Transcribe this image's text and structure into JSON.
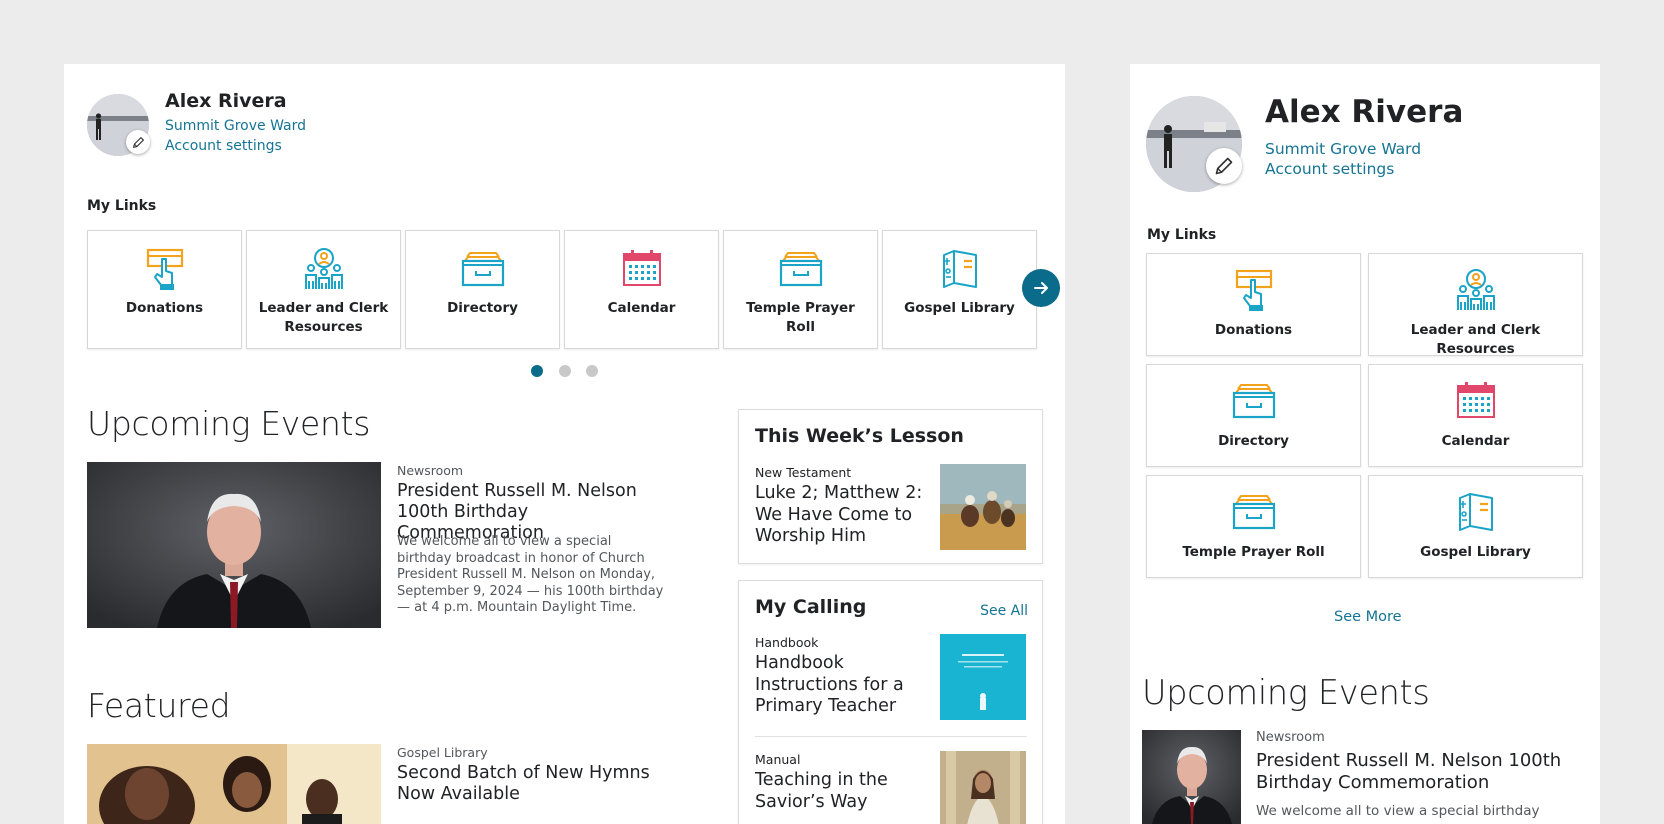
{
  "colors": {
    "page_bg": "#ececec",
    "link": "#157493",
    "accent_blue": "#0b6b8a",
    "icon_orange": "#f3a21b",
    "icon_teal": "#1aa4c7",
    "icon_pink": "#e0476a"
  },
  "user": {
    "name": "Alex Rivera",
    "ward": "Summit Grove Ward",
    "account_settings": "Account settings"
  },
  "my_links": {
    "label": "My Links",
    "items": [
      {
        "label": "Donations",
        "icon": "donation-hand-icon"
      },
      {
        "label": "Leader and Clerk Resources",
        "icon": "leader-people-icon"
      },
      {
        "label": "Directory",
        "icon": "directory-drawer-icon"
      },
      {
        "label": "Calendar",
        "icon": "calendar-icon"
      },
      {
        "label": "Temple Prayer Roll",
        "icon": "prayer-roll-drawer-icon"
      },
      {
        "label": "Gospel Library",
        "icon": "gospel-library-book-icon"
      }
    ],
    "carousel_pages": 3,
    "carousel_active": 1,
    "see_more": "See More"
  },
  "upcoming_events": {
    "heading": "Upcoming Events",
    "item": {
      "eyebrow": "Newsroom",
      "title": "President Russell M. Nelson 100th Birthday Commemoration",
      "description": "We welcome all to view a special birthday broadcast in honor of Church President Russell M. Nelson on Monday, September 9, 2024 — his 100th birthday — at 4 p.m. Mountain Daylight Time.",
      "mobile_description_visible": "We welcome all to view a special birthday"
    }
  },
  "featured": {
    "heading": "Featured",
    "item": {
      "eyebrow": "Gospel Library",
      "title": "Second Batch of New Hymns Now Available"
    }
  },
  "lesson": {
    "heading": "This Week’s Lesson",
    "eyebrow": "New Testament",
    "title": "Luke 2; Matthew 2: We Have Come to Worship Him"
  },
  "calling": {
    "heading": "My Calling",
    "see_all": "See All",
    "items": [
      {
        "eyebrow": "Handbook",
        "title": "Handbook Instructions for a Primary Teacher"
      },
      {
        "eyebrow": "Manual",
        "title": "Teaching in the Savior’s Way"
      }
    ]
  }
}
